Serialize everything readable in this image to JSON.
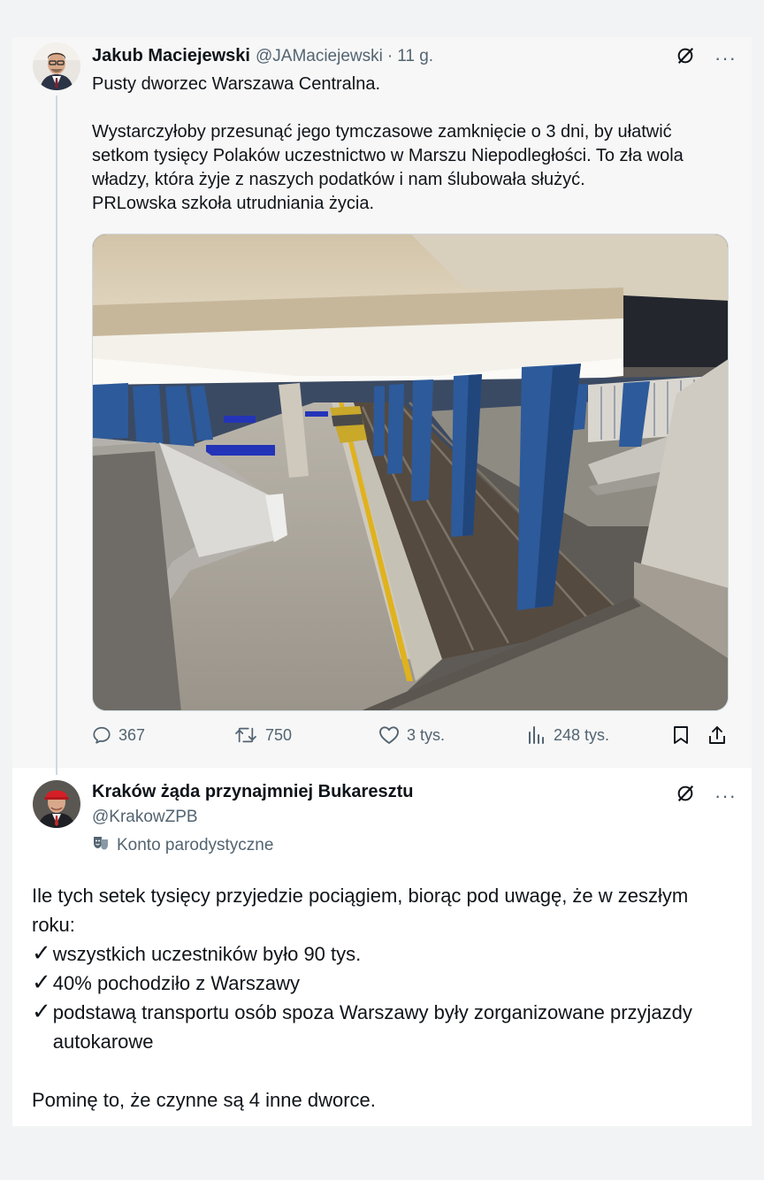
{
  "tweet1": {
    "author_name": "Jakub Maciejewski",
    "handle": "@JAMaciejewski",
    "separator": "·",
    "time": "11 g.",
    "text_title": "Pusty dworzec Warszawa Centralna.",
    "text_body": "Wystarczyłoby przesunąć jego tymczasowe zamknięcie o 3 dni, by ułatwić\nsetkom tysięcy Polaków uczestnictwo w Marszu Niepodległości. To zła wola\nwładzy, która żyje z naszych podatków i nam ślubowała służyć.\nPRLowska szkoła utrudniania życia.",
    "more_label": "···",
    "stats": {
      "replies": "367",
      "retweets": "750",
      "likes": "3 tys.",
      "views": "248 tys."
    }
  },
  "tweet2": {
    "author_name": "Kraków żąda przynajmniej Bukaresztu",
    "handle": "@KrakowZPB",
    "parody_label": "Konto parodystyczne",
    "more_label": "···",
    "intro": "Ile tych setek tysięcy przyjedzie pociągiem, biorąc pod uwagę, że w zeszłym roku:",
    "check_symbol": "✓",
    "bullets": [
      "wszystkich uczestników było 90 tys.",
      "40% pochodziło z Warszawy",
      "podstawą transportu osób spoza Warszawy były zorganizowane przyjazdy autokarowe"
    ],
    "outro": "Pominę to, że czynne są 4 inne dworce."
  },
  "colors": {
    "text_primary": "#0f1419",
    "text_secondary": "#536471",
    "thread_line": "#cfd9de",
    "platform_pillar": "#2d5a9a",
    "platform_stripe": "#e0b21c"
  }
}
